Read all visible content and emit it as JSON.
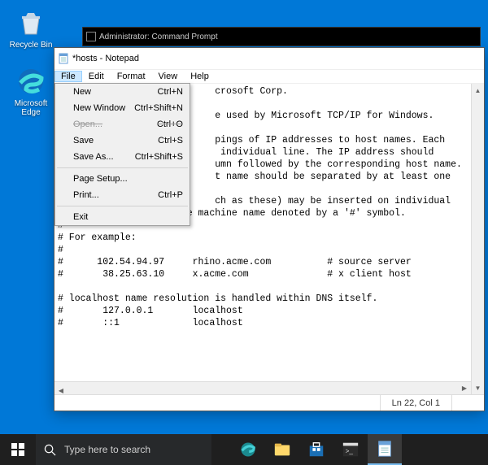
{
  "desktop": {
    "icons": [
      {
        "label": "Recycle Bin"
      },
      {
        "label": "Microsoft\nEdge"
      }
    ]
  },
  "cmd": {
    "title": "Administrator: Command Prompt"
  },
  "notepad": {
    "title": "*hosts - Notepad",
    "menubar": [
      "File",
      "Edit",
      "Format",
      "View",
      "Help"
    ],
    "file_menu": {
      "items": [
        {
          "label": "New",
          "shortcut": "Ctrl+N",
          "disabled": false
        },
        {
          "label": "New Window",
          "shortcut": "Ctrl+Shift+N",
          "disabled": false
        },
        {
          "label": "Open...",
          "shortcut": "Ctrl+O",
          "disabled": true
        },
        {
          "label": "Save",
          "shortcut": "Ctrl+S",
          "disabled": false,
          "highlight": true
        },
        {
          "label": "Save As...",
          "shortcut": "Ctrl+Shift+S",
          "disabled": false
        }
      ],
      "items2": [
        {
          "label": "Page Setup...",
          "shortcut": ""
        },
        {
          "label": "Print...",
          "shortcut": "Ctrl+P"
        }
      ],
      "items3": [
        {
          "label": "Exit",
          "shortcut": ""
        }
      ]
    },
    "content": "                            crosoft Corp.\n\n                            e used by Microsoft TCP/IP for Windows.\n\n                            pings of IP addresses to host names. Each\n                             individual line. The IP address should\n                            umn followed by the corresponding host name.\n                            t name should be separated by at least one\n\n                            ch as these) may be inserted on individual\n# lines or following the machine name denoted by a '#' symbol.\n#\n# For example:\n#\n#      102.54.94.97     rhino.acme.com          # source server\n#       38.25.63.10     x.acme.com              # x client host\n\n# localhost name resolution is handled within DNS itself.\n#       127.0.0.1       localhost\n#       ::1             localhost",
    "status": {
      "pos": "Ln 22, Col 1"
    }
  },
  "taskbar": {
    "search_placeholder": "Type here to search"
  }
}
